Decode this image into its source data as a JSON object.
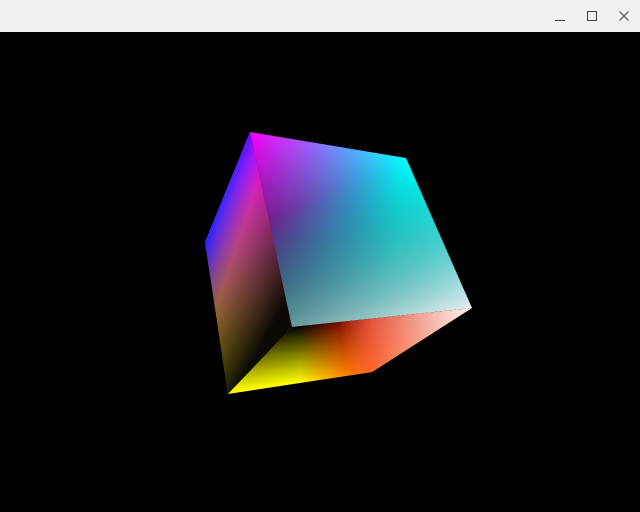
{
  "window": {
    "title": "",
    "background_color": "#000000",
    "titlebar_color": "#f1f1f1",
    "controls": [
      {
        "name": "minimize",
        "icon": "minimize-icon"
      },
      {
        "name": "maximize",
        "icon": "maximize-icon"
      },
      {
        "name": "close",
        "icon": "close-icon"
      }
    ]
  },
  "scene": {
    "object": "rgb-color-cube",
    "vertex_colors": {
      "magenta": "#ff00ff",
      "cyan": "#00ffff",
      "blue": "#0000ff",
      "white": "#ffffff",
      "black": "#000000",
      "yellow": "#ffff00",
      "red": "#ff0000"
    }
  }
}
